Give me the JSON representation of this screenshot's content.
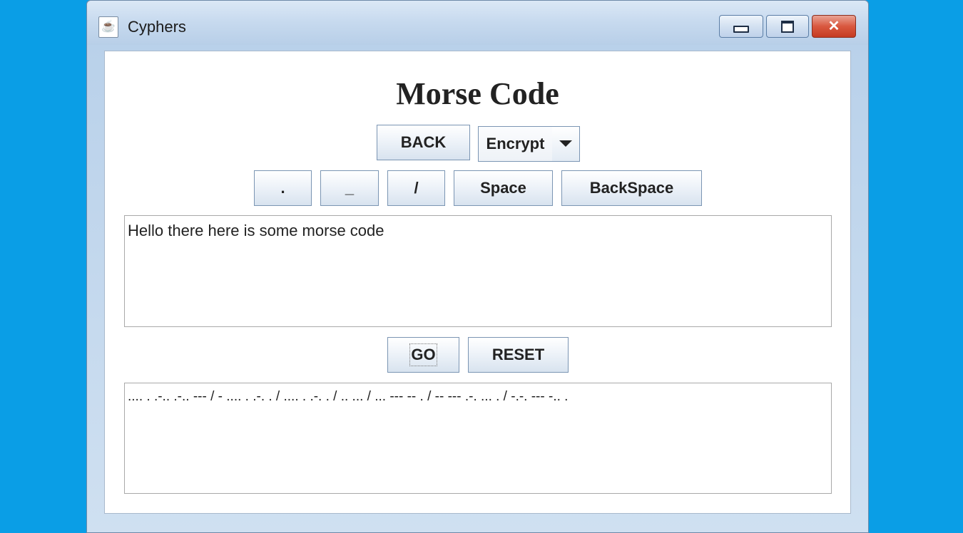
{
  "window": {
    "title": "Cyphers",
    "controls": {
      "minimize": "minimize",
      "maximize": "maximize",
      "close": "✕"
    }
  },
  "main": {
    "heading": "Morse Code",
    "back_label": "BACK",
    "mode": {
      "selected": "Encrypt"
    },
    "keypad": [
      ".",
      "_",
      "/",
      "Space",
      "BackSpace"
    ],
    "input_text": "Hello there here is some morse code",
    "go_label": "GO",
    "reset_label": "RESET",
    "output_text": ".... . .-.. .-.. --- / - .... . .-. . / .... . .-. . / .. ... / ... --- -- . / -- --- .-. ... . / -.-. --- -.. ."
  },
  "colors": {
    "desktop": "#0aa0e8",
    "window_frame": "#c6d9ee",
    "close_button": "#d9583f"
  }
}
